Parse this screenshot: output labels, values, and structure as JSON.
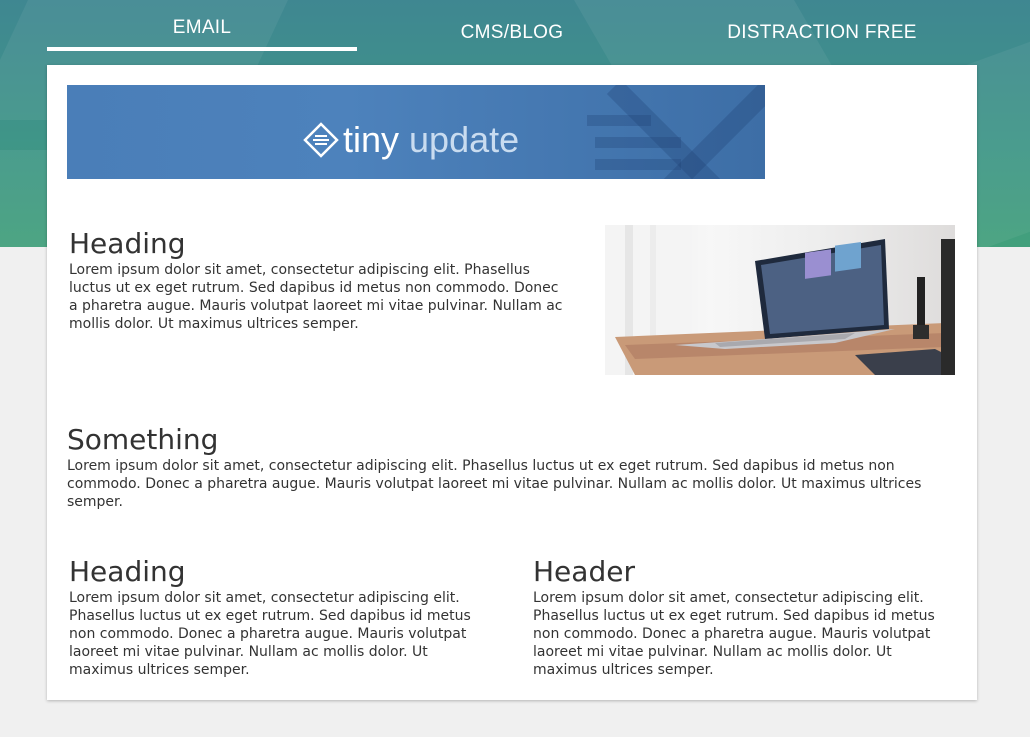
{
  "tabs": [
    {
      "label": "EMAIL",
      "active": true
    },
    {
      "label": "CMS/BLOG",
      "active": false
    },
    {
      "label": "DISTRACTION FREE",
      "active": false
    }
  ],
  "banner": {
    "logo_word1": "tiny",
    "logo_word2": "update"
  },
  "sections": {
    "top": {
      "heading": "Heading",
      "body": "Lorem ipsum dolor sit amet, consectetur adipiscing elit. Phasellus luctus ut ex eget rutrum. Sed dapibus id metus non commodo. Donec a pharetra augue. Mauris volutpat laoreet mi vitae pulvinar. Nullam ac mollis dolor. Ut maximus ultrices semper."
    },
    "middle": {
      "heading": "Something",
      "body": "Lorem ipsum dolor sit amet, consectetur adipiscing elit. Phasellus luctus ut ex eget rutrum. Sed dapibus id metus non commodo. Donec a pharetra augue. Mauris volutpat laoreet mi vitae pulvinar. Nullam ac mollis dolor. Ut maximus ultrices semper."
    },
    "bottom_left": {
      "heading": "Heading",
      "body": "Lorem ipsum dolor sit amet, consectetur adipiscing elit. Phasellus luctus ut ex eget rutrum. Sed dapibus id metus non commodo. Donec a pharetra augue. Mauris volutpat laoreet mi vitae pulvinar. Nullam ac mollis dolor. Ut maximus ultrices semper."
    },
    "bottom_right": {
      "heading": "Header",
      "body": "Lorem ipsum dolor sit amet, consectetur adipiscing elit. Phasellus luctus ut ex eget rutrum. Sed dapibus id metus non commodo. Donec a pharetra augue. Mauris volutpat laoreet mi vitae pulvinar. Nullam ac mollis dolor. Ut maximus ultrices semper."
    }
  },
  "image": {
    "icon": "laptop-photo"
  },
  "colors": {
    "hero_top": "#3f8791",
    "hero_bottom": "#42a07c",
    "banner_blue": "#4a7eb8",
    "text": "#333333",
    "page_bg": "#f0f0f0"
  }
}
